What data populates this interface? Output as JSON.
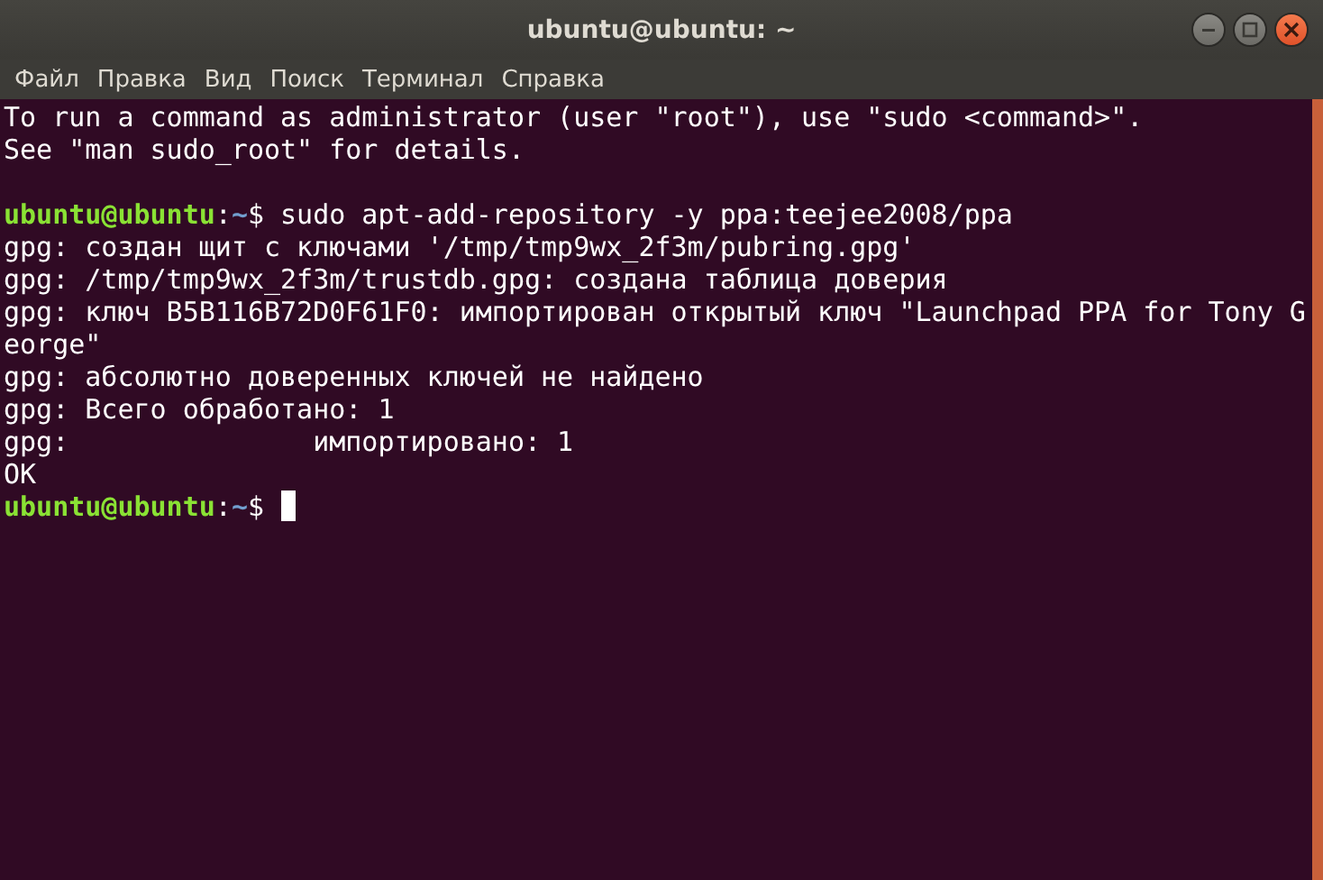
{
  "window": {
    "title": "ubuntu@ubuntu: ~"
  },
  "menu": [
    "Файл",
    "Правка",
    "Вид",
    "Поиск",
    "Терминал",
    "Справка"
  ],
  "lines": [
    {
      "kind": "output",
      "text": "To run a command as administrator (user \"root\"), use \"sudo <command>\"."
    },
    {
      "kind": "output",
      "text": "See \"man sudo_root\" for details."
    },
    {
      "kind": "blank"
    },
    {
      "kind": "prompt",
      "user": "ubuntu@ubuntu",
      "separator": ":",
      "path": "~",
      "sigil": "$",
      "command": "sudo apt-add-repository -y ppa:teejee2008/ppa",
      "cursor": false
    },
    {
      "kind": "output",
      "text": "gpg: создан щит с ключами '/tmp/tmp9wx_2f3m/pubring.gpg'"
    },
    {
      "kind": "output",
      "text": "gpg: /tmp/tmp9wx_2f3m/trustdb.gpg: создана таблица доверия"
    },
    {
      "kind": "output",
      "text": "gpg: ключ B5B116B72D0F61F0: импортирован открытый ключ \"Launchpad PPA for Tony G"
    },
    {
      "kind": "output",
      "text": "eorge\""
    },
    {
      "kind": "output",
      "text": "gpg: абсолютно доверенных ключей не найдено"
    },
    {
      "kind": "output",
      "text": "gpg: Всего обработано: 1"
    },
    {
      "kind": "output",
      "text": "gpg:               импортировано: 1"
    },
    {
      "kind": "output",
      "text": "OK"
    },
    {
      "kind": "prompt",
      "user": "ubuntu@ubuntu",
      "separator": ":",
      "path": "~",
      "sigil": "$",
      "cursor": true
    }
  ]
}
